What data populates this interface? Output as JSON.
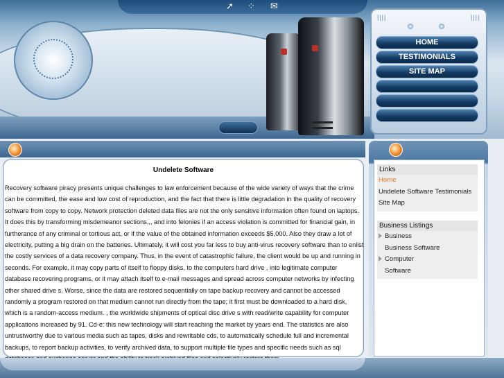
{
  "header": {
    "icons": [
      "home-arrow-icon",
      "sitemap-icon",
      "mail-icon"
    ],
    "nav": [
      {
        "label": "HOME"
      },
      {
        "label": "TESTIMONIALS"
      },
      {
        "label": "SITE MAP"
      },
      {
        "label": ""
      },
      {
        "label": ""
      },
      {
        "label": ""
      }
    ]
  },
  "main": {
    "title": "Undelete Software",
    "body": "Recovery software piracy presents unique challenges to law enforcement because of the wide variety of ways that the crime can be committed, the ease and low cost of reproduction, and the fact that there is little degradation in the quality of recovery software from copy to copy. Network protection deleted data files are not the only sensitive information often found on laptops. It does this by transforming misdemeanor sections,,, and into felonies if an access violation is committed for financial gain, in furtherance of any criminal or tortious act, or if the value of the obtained information exceeds $5,000. Also they draw a lot of electricity, putting a big drain on the batteries. Ultimately, it will cost you far less to buy anti-virus recovery software than to enlist the costly services of a data recovery company. Thus, in the event of catastrophic failure, the client would be up and running in seconds. For example, it may copy parts of itself to floppy disks, to the computers hard drive , into legitimate computer database recovering programs, or it may attach itself to e-mail messages and spread across computer networks by infecting other shared drive s. Worse, since the data are restored sequentially on tape backup recovery and cannot be accessed randomly a program restored on that medium cannot run directly from the tape; it first must be downloaded to a hard disk, which is a random-access medium. , the worldwide shipments of optical disc drive s with read/write capability for computer applications increased by 91. Cd-e: this new technology will start reaching the market by years end. The statistics are also untrustworthy due to various media such as tapes, disks and rewritable cds, to automatically schedule full and incremental backups, to report backup activities, to verify archived data, to support multiple file types and specific needs such as sql databases and exchange server and the ability to track archived files and selectively restore them."
  },
  "sidebar": {
    "links_title": "Links",
    "links": [
      {
        "label": "Home",
        "active": true
      },
      {
        "label": "Undelete Software Testimonials",
        "active": false
      },
      {
        "label": "Site Map",
        "active": false
      }
    ],
    "listings_title": "Business Listings",
    "listings": [
      {
        "label": "Business",
        "expandable": true
      },
      {
        "label": "Business Software",
        "expandable": false
      },
      {
        "label": "Computer",
        "expandable": true
      },
      {
        "label": "Software",
        "expandable": false
      }
    ]
  },
  "colors": {
    "accent": "#e8741b",
    "nav_button": "#143c66",
    "frame": "#7f9dba"
  }
}
